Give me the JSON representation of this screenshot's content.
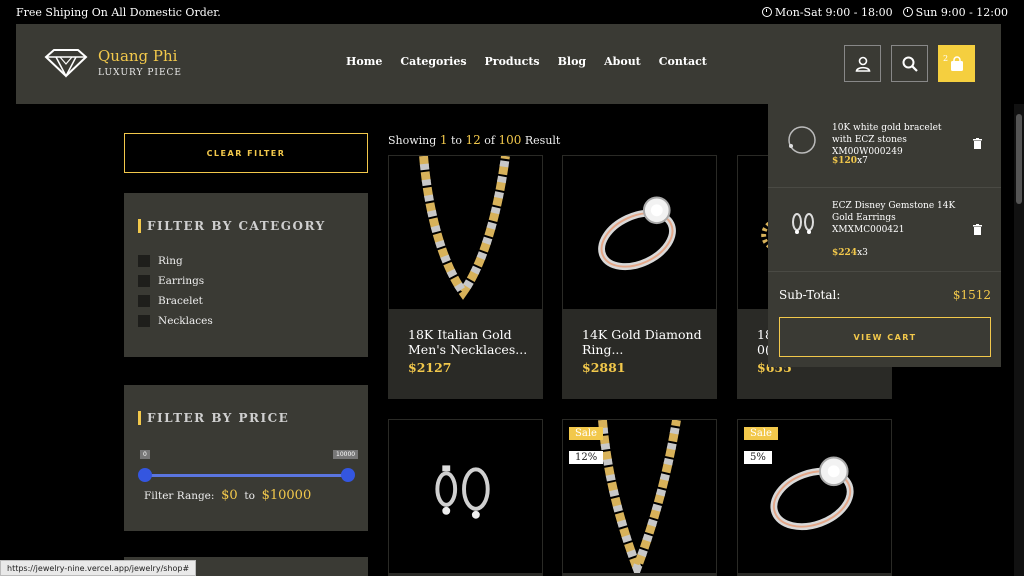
{
  "topbar": {
    "shipping": "Free Shiping On All Domestic Order.",
    "hours_weekday": "Mon-Sat 9:00 - 18:00",
    "hours_sunday": "Sun 9:00 - 12:00"
  },
  "brand": {
    "name": "Quang Phi",
    "tagline": "LUXURY PIECE"
  },
  "nav": [
    "Home",
    "Categories",
    "Products",
    "Blog",
    "About",
    "Contact"
  ],
  "cart_count": "2",
  "sidebar": {
    "clear_filter": "CLEAR FILTER",
    "category_title": "FILTER BY CATEGORY",
    "categories": [
      "Ring",
      "Earrings",
      "Bracelet",
      "Necklaces"
    ],
    "price_title": "FILTER BY PRICE",
    "slider_min_tip": "0",
    "slider_max_tip": "10000",
    "range_label": "Filter Range:",
    "range_min": "$0",
    "range_to": "to",
    "range_max": "$10000"
  },
  "results": {
    "prefix": "Showing",
    "from": "1",
    "to_word": "to",
    "to": "12",
    "of_word": "of",
    "total": "100",
    "suffix": "Result"
  },
  "products": [
    {
      "name": "18K Italian Gold Men's Necklaces...",
      "price": "$2127"
    },
    {
      "name": "14K Gold Diamond Ring...",
      "price": "$2881"
    },
    {
      "name": "18",
      "name2": "0(",
      "price": "$655"
    },
    {
      "name": "",
      "price": ""
    },
    {
      "name": "",
      "price": "",
      "sale": "Sale",
      "discount": "12%"
    },
    {
      "name": "",
      "price": "",
      "sale": "Sale",
      "discount": "5%"
    }
  ],
  "cart": {
    "items": [
      {
        "name": "10K white gold bracelet with ECZ stones XM00W000249",
        "price": "$120",
        "qty": "x7"
      },
      {
        "name": "ECZ Disney Gemstone 14K Gold Earrings XMXMC000421",
        "price": "$224",
        "qty": "x3"
      }
    ],
    "subtotal_label": "Sub-Total:",
    "subtotal_value": "$1512",
    "view_cart": "VIEW CART"
  },
  "status_url": "https://jewelry-nine.vercel.app/jewelry/shop#",
  "colors": {
    "accent": "#f2c84b",
    "panel": "#3a3a34",
    "slider": "#3456e0"
  }
}
